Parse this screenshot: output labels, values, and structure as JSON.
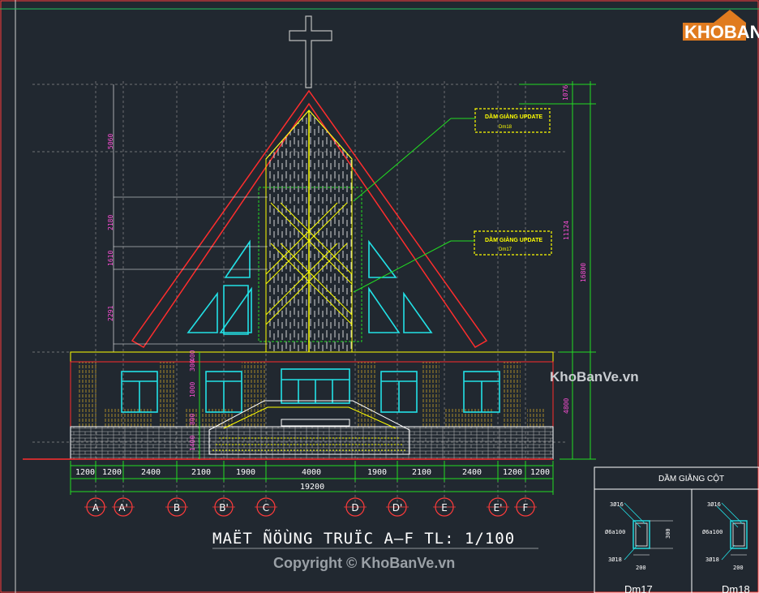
{
  "logo": {
    "text": "KHOBANVE"
  },
  "watermarks": {
    "side": "KhoBanVe.vn",
    "copyright": "Copyright © KhoBanVe.vn"
  },
  "title": "MAËT ÑÖÙNG TRUÏC A–F  TL: 1/100",
  "notes": [
    {
      "heading": "DẦM GIẰNG UPDATE",
      "sub": "Dm18"
    },
    {
      "heading": "DẦM GIẰNG UPDATE",
      "sub": "Dm17"
    }
  ],
  "dims_bottom": [
    "1200",
    "1200",
    "2400",
    "2100",
    "1900",
    "4000",
    "1900",
    "2100",
    "2400",
    "1200",
    "1200"
  ],
  "dim_total": "19200",
  "dims_right": [
    "1076",
    "11124",
    "16800",
    "4800"
  ],
  "dims_left_upper": [
    "5060",
    "2180",
    "1610",
    "2291"
  ],
  "dims_left_lower": [
    "400",
    "300",
    "1000",
    "800",
    "1400"
  ],
  "axes": [
    "A",
    "A'",
    "B",
    "B'",
    "C",
    "D",
    "D'",
    "E",
    "E'",
    "F"
  ],
  "beam_table": {
    "title": "DẦM GIẰNG CỘT",
    "rebar": {
      "top": "3Ø16",
      "stirrup": "Ø6a100",
      "bottom": "3Ø18",
      "height": "300",
      "width": "200"
    },
    "beam_names": [
      "Dm17",
      "Dm18"
    ]
  },
  "colors": {
    "background": "#212830",
    "roof": "#ff2d2d",
    "glass": "#22e1e6",
    "wall_hatch": "#c9a227",
    "dim": "#22dd22",
    "axis": "#ff3b3b",
    "note": "#ffff00"
  }
}
